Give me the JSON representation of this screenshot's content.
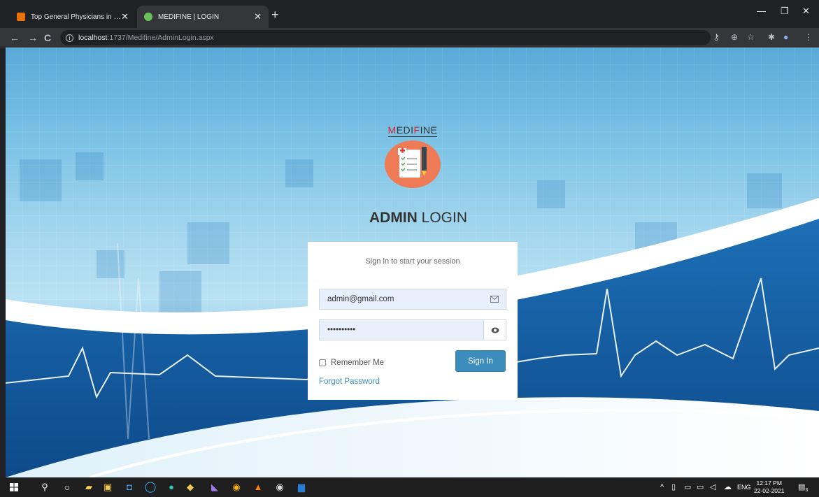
{
  "browser": {
    "tabs": [
      {
        "label": "Top General Physicians in Sangli",
        "active": false
      },
      {
        "label": "MEDIFINE | LOGIN",
        "active": true
      }
    ],
    "address": {
      "host": "localhost",
      "path": ":1737/Medifine/AdminLogin.aspx"
    }
  },
  "brand": {
    "letter_red": "M",
    "mid_dark": "EDI",
    "letter_red2": "F",
    "tail_dark": "INE"
  },
  "heading": {
    "bold": "ADMIN",
    "rest": " LOGIN"
  },
  "login": {
    "message": "Sign in to start your session",
    "email_value": "admin@gmail.com",
    "password_value": "••••••••••",
    "remember_label": "Remember Me",
    "signin_label": "Sign In",
    "forgot_label": "Forgot Password"
  },
  "taskbar": {
    "lang": "ENG",
    "time": "12:17 PM",
    "date": "22-02-2021",
    "notif_count": "3"
  },
  "colors": {
    "accent": "#3c8dbc",
    "brand_red": "#d9232d",
    "logo_bg": "#ef7b56"
  }
}
